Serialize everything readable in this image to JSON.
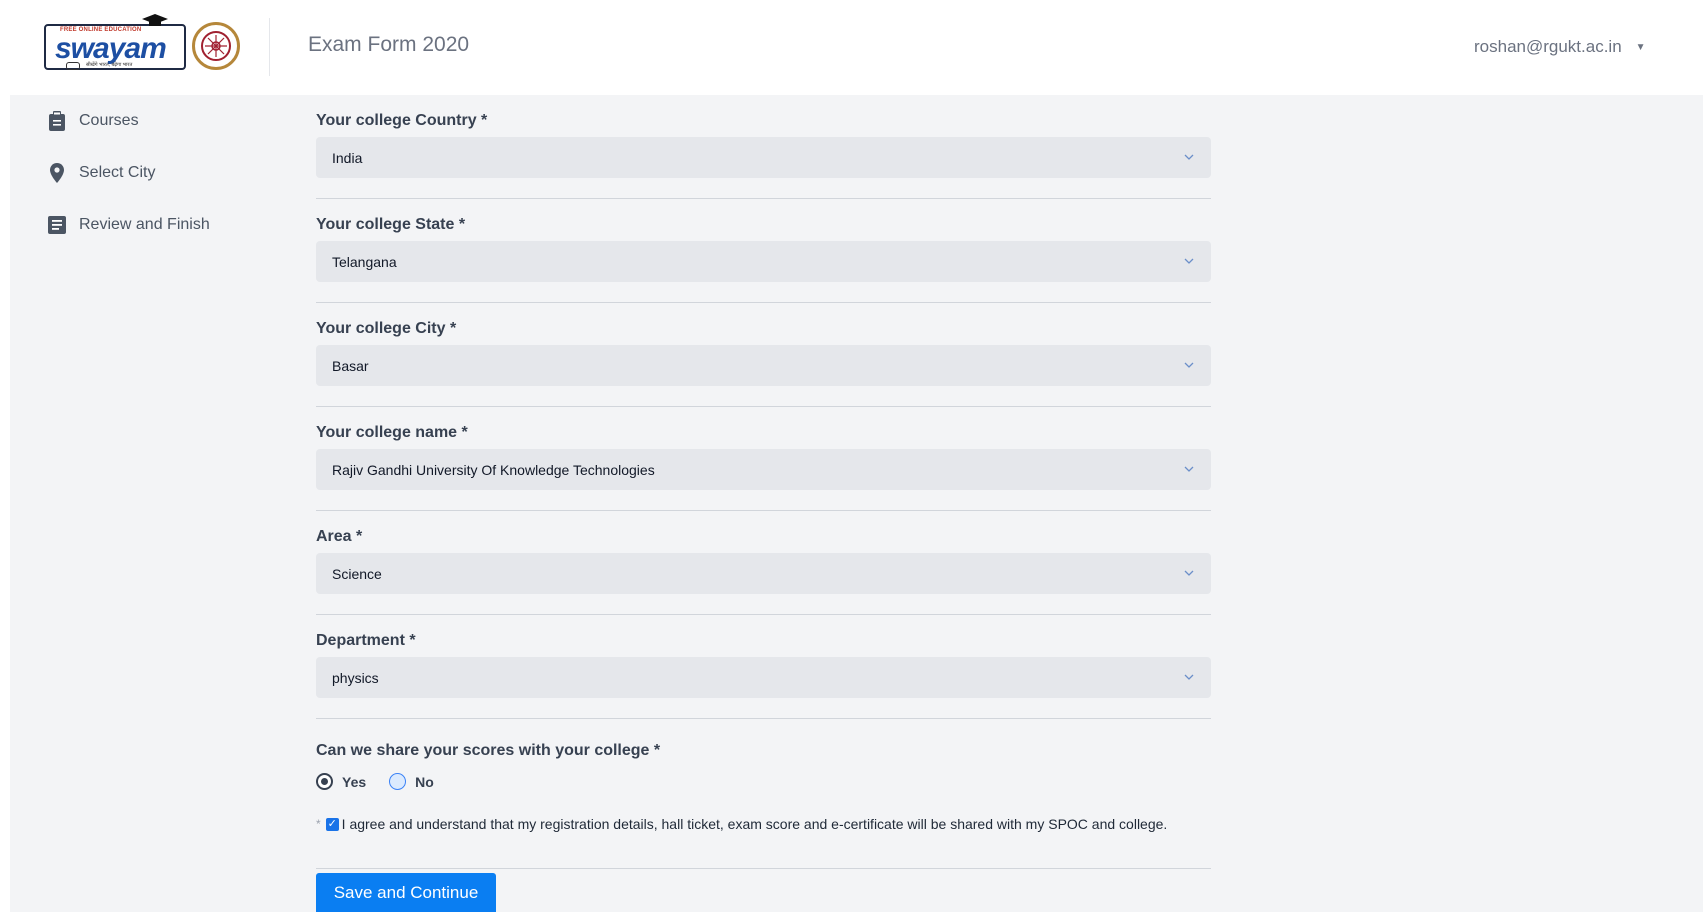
{
  "header": {
    "logo_tag": "FREE ONLINE EDUCATION",
    "logo_word": "swayam",
    "logo_sub": "सीखेंगे भारत, बढ़ेगा भारत",
    "title": "Exam Form 2020",
    "user_email": "roshan@rgukt.ac.in",
    "caret": "▼"
  },
  "sidebar": {
    "items": [
      {
        "label": "Courses",
        "icon": "clipboard-icon"
      },
      {
        "label": "Select City",
        "icon": "location-pin-icon"
      },
      {
        "label": "Review and Finish",
        "icon": "document-list-icon"
      }
    ]
  },
  "form": {
    "fields": [
      {
        "label": "Your college Country *",
        "value": "India"
      },
      {
        "label": "Your college State *",
        "value": "Telangana"
      },
      {
        "label": "Your college City *",
        "value": "Basar"
      },
      {
        "label": "Your college name *",
        "value": "Rajiv Gandhi University Of Knowledge Technologies"
      },
      {
        "label": "Area *",
        "value": "Science"
      },
      {
        "label": "Department *",
        "value": "physics"
      }
    ],
    "share": {
      "label": "Can we share your scores with your college *",
      "options": [
        {
          "label": "Yes",
          "selected": true
        },
        {
          "label": "No",
          "selected": false
        }
      ]
    },
    "agree": {
      "star": "*",
      "text": "I agree and understand that my registration details, hall ticket, exam score and e-certificate will be shared with my SPOC and college.",
      "checked": true
    },
    "submit_label": "Save and Continue"
  },
  "colors": {
    "accent": "#0a7ef2",
    "field_bg": "#e5e7eb",
    "page_bg": "#f3f4f6"
  }
}
